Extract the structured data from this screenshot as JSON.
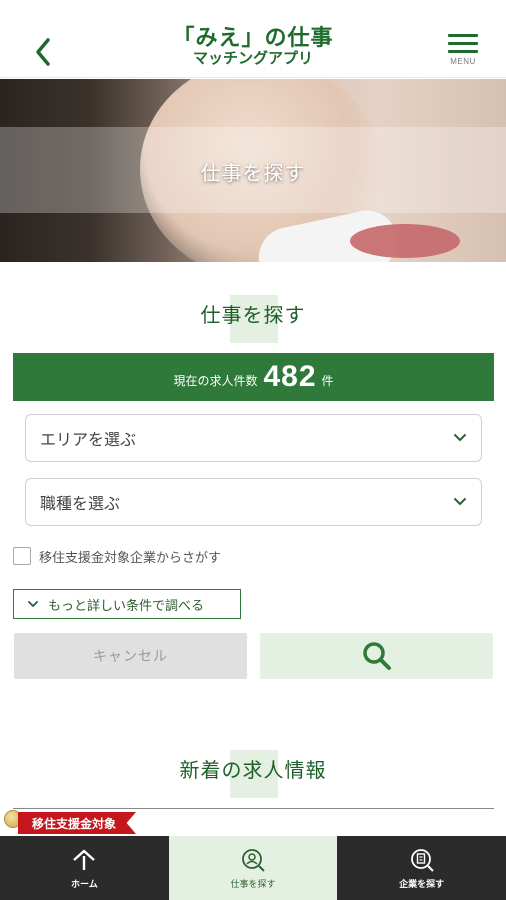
{
  "header": {
    "logo_line1": "「みえ」の仕事",
    "logo_line2": "マッチングアプリ",
    "menu_label": "MENU",
    "back_icon": "chevron-left-icon",
    "menu_icon": "hamburger-icon"
  },
  "hero": {
    "title": "仕事を探す"
  },
  "search_section": {
    "title": "仕事を探す",
    "count_label": "現在の求人件数",
    "count_value": "482",
    "count_unit": "件",
    "area_select": "エリアを選ぶ",
    "job_type_select": "職種を選ぶ",
    "subsidy_checkbox_label": "移住支援金対象企業からさがす",
    "subsidy_checked": false,
    "more_conditions_label": "もっと詳しい条件で調べる",
    "cancel_label": "キャンセル",
    "search_icon": "search-icon"
  },
  "new_listings": {
    "title": "新着の求人情報",
    "ribbon_label": "移住支援金対象"
  },
  "bottom_nav": {
    "items": [
      {
        "label": "ホーム",
        "icon": "home-icon",
        "active": false
      },
      {
        "label": "仕事を探す",
        "icon": "job-search-icon",
        "active": true
      },
      {
        "label": "企業を探す",
        "icon": "company-search-icon",
        "active": false
      }
    ]
  },
  "colors": {
    "brand_green": "#2f7a3b",
    "logo_green": "#1f6b2e",
    "light_green": "#e4f1e2",
    "ribbon_red": "#c4161c",
    "nav_dark": "#2b2b2b"
  }
}
